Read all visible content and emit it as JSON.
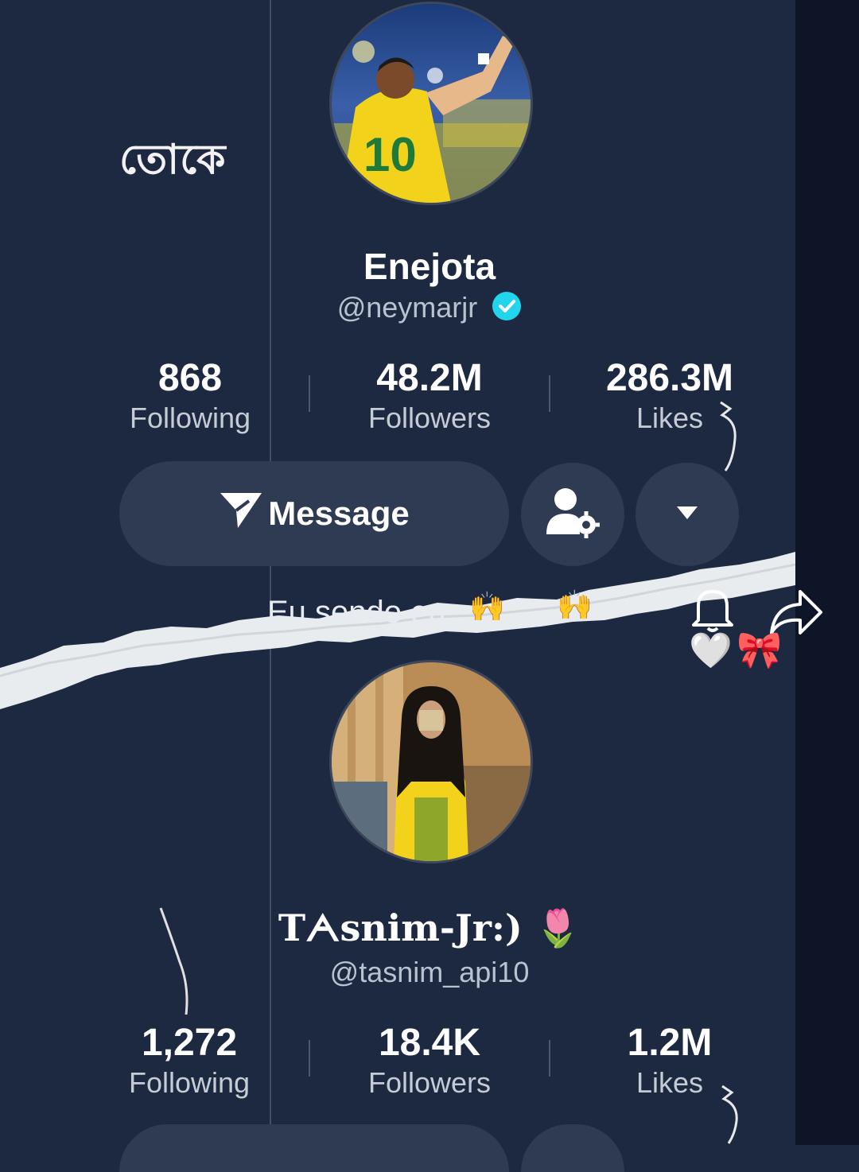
{
  "overlay_text": "তোকে",
  "profile1": {
    "display_name": "Enejota",
    "handle": "@neymarjr",
    "verified": true,
    "stats": [
      {
        "value": "868",
        "label": "Following"
      },
      {
        "value": "48.2M",
        "label": "Followers"
      },
      {
        "value": "286.3M",
        "label": "Likes"
      }
    ],
    "message_label": "Message",
    "bio": "Eu sendo eu"
  },
  "profile2": {
    "display_name": "Tᗅsnim-Jr:)",
    "name_emoji": "🌷",
    "handle": "@tasnim_api10",
    "stats": [
      {
        "value": "1,272",
        "label": "Following"
      },
      {
        "value": "18.4K",
        "label": "Followers"
      },
      {
        "value": "1.2M",
        "label": "Likes"
      }
    ]
  },
  "decorations": {
    "heart": "🤍",
    "bow": "🎀",
    "hands": "🙌"
  },
  "colors": {
    "background": "#1c2940",
    "button": "#2f3b52",
    "verified": "#20d5ec"
  }
}
